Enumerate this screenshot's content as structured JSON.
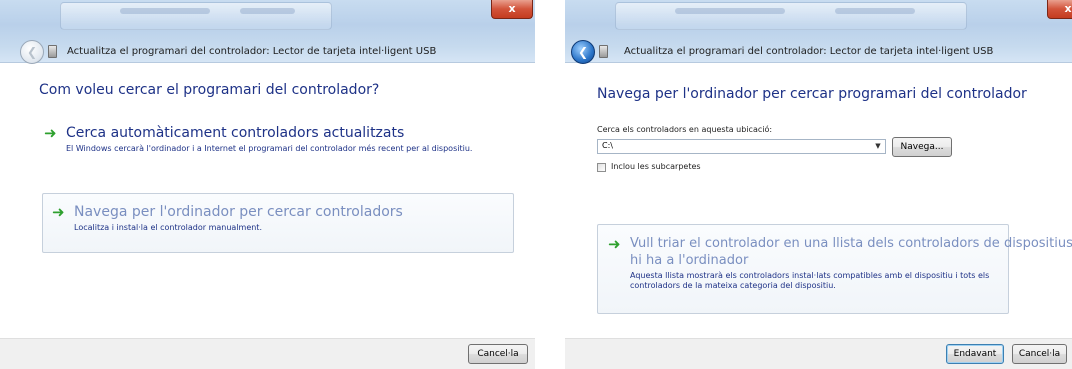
{
  "left_window": {
    "title": "Actualitza el programari del controlador: Lector de tarjeta intel·ligent USB",
    "close_label": "x",
    "heading": "Com voleu cercar el programari del controlador?",
    "option1": {
      "title": "Cerca automàticament controladors actualitzats",
      "description": "El Windows cercarà l'ordinador i a Internet el programari del controlador més recent per al dispositiu."
    },
    "option2": {
      "title": "Navega per l'ordinador per cercar controladors",
      "description": "Localitza i instal·la el controlador manualment."
    },
    "cancel_label": "Cancel·la"
  },
  "right_window": {
    "title": "Actualitza el programari del controlador: Lector de tarjeta intel·ligent USB",
    "close_label": "x",
    "heading": "Navega per l'ordinador per cercar programari del controlador",
    "search_location_label": "Cerca els controladors en aquesta ubicació:",
    "path_value": "C:\\",
    "browse_label": "Navega...",
    "include_subfolders_label": "Inclou les subcarpetes",
    "include_subfolders_checked": false,
    "option": {
      "title_line1": "Vull triar el controlador en una llista dels controladors de dispositius que",
      "title_line2": "hi ha a l'ordinador",
      "description_line1": "Aquesta llista mostrarà els controladors instal·lats compatibles amb el dispositiu i tots els",
      "description_line2": "controladors de la mateixa categoria del dispositiu."
    },
    "next_label": "Endavant",
    "cancel_label": "Cancel·la"
  },
  "icons": {
    "back": "back-arrow-icon",
    "device": "smart-card-reader-icon",
    "option_arrow": "green-arrow-icon",
    "close": "close-icon"
  },
  "colors": {
    "link_blue": "#1e3287",
    "arrow_green": "#2ea02e",
    "close_red": "#c43c20",
    "glass_blue": "#b9d0ea"
  }
}
